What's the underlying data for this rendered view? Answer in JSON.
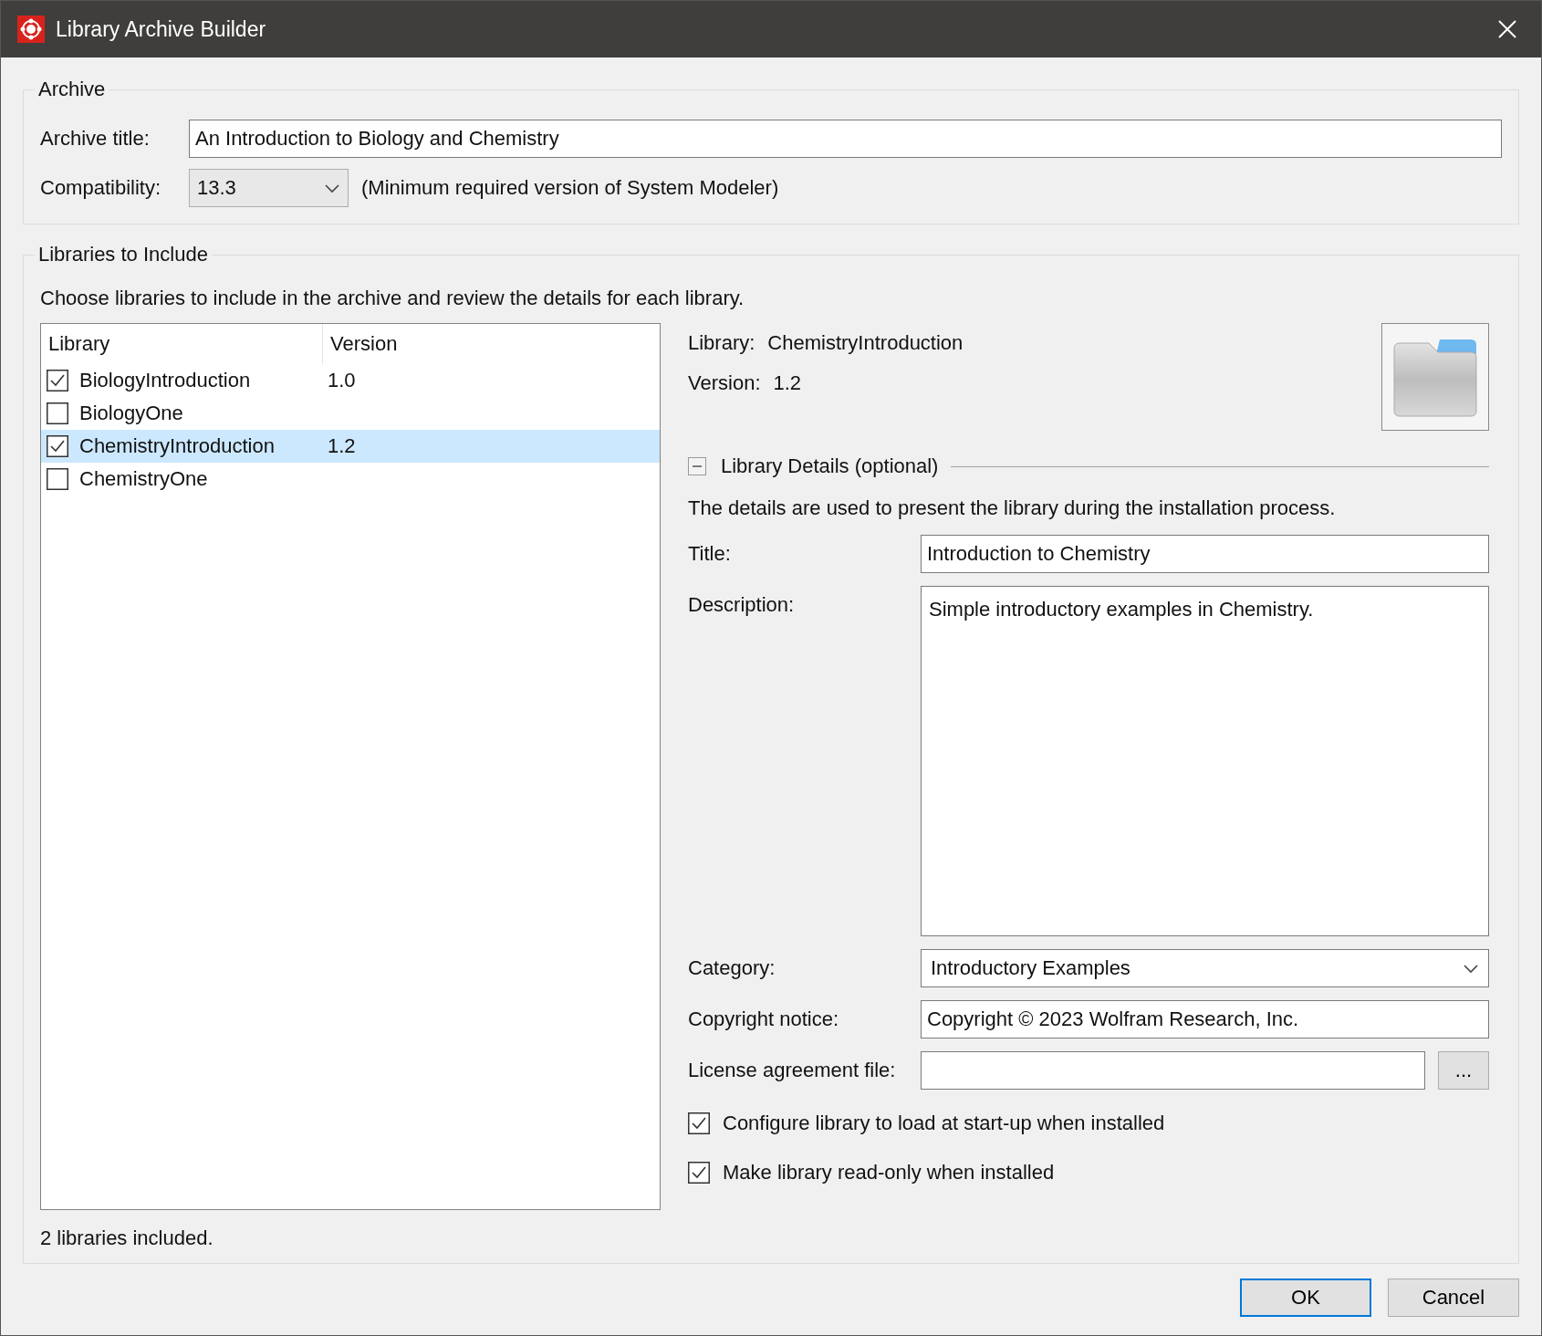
{
  "window": {
    "title": "Library Archive Builder"
  },
  "archive": {
    "legend": "Archive",
    "title_label": "Archive title:",
    "title_value": "An Introduction to Biology and Chemistry",
    "compat_label": "Compatibility:",
    "compat_value": "13.3",
    "compat_note": "(Minimum required version of System Modeler)"
  },
  "libraries": {
    "legend": "Libraries to Include",
    "instructions": "Choose libraries to include in the archive and review the details for each library.",
    "columns": [
      "Library",
      "Version"
    ],
    "rows": [
      {
        "name": "BiologyIntroduction",
        "version": "1.0",
        "checked": true,
        "selected": false
      },
      {
        "name": "BiologyOne",
        "checked": false,
        "selected": false
      },
      {
        "name": "ChemistryIntroduction",
        "version": "1.2",
        "checked": true,
        "selected": true
      },
      {
        "name": "ChemistryOne",
        "checked": false,
        "selected": false
      }
    ],
    "summary": "2 libraries included."
  },
  "details": {
    "library_label": "Library:",
    "library_value": "ChemistryIntroduction",
    "version_label": "Version:",
    "version_value": "1.2",
    "section_title": "Library Details (optional)",
    "expanded": true,
    "intro": "The details are used to present the library during the installation process.",
    "fields": [
      {
        "kind": "text",
        "label": "Title:",
        "value": "Introduction to Chemistry"
      },
      {
        "kind": "textarea",
        "label": "Description:",
        "value": "Simple introductory examples in Chemistry."
      },
      {
        "kind": "dropdown",
        "label": "Category:",
        "value": "Introductory Examples"
      },
      {
        "kind": "text",
        "label": "Copyright notice:",
        "value": "Copyright © 2023 Wolfram Research, Inc."
      },
      {
        "kind": "file",
        "label": "License agreement file:",
        "button": "..."
      }
    ],
    "options": [
      {
        "label": "Configure library to load at start-up when installed",
        "checked": true
      },
      {
        "label": "Make library read-only when installed",
        "checked": true
      }
    ]
  },
  "buttons": [
    {
      "label": "OK",
      "default": true
    },
    {
      "label": "Cancel",
      "default": false
    }
  ]
}
